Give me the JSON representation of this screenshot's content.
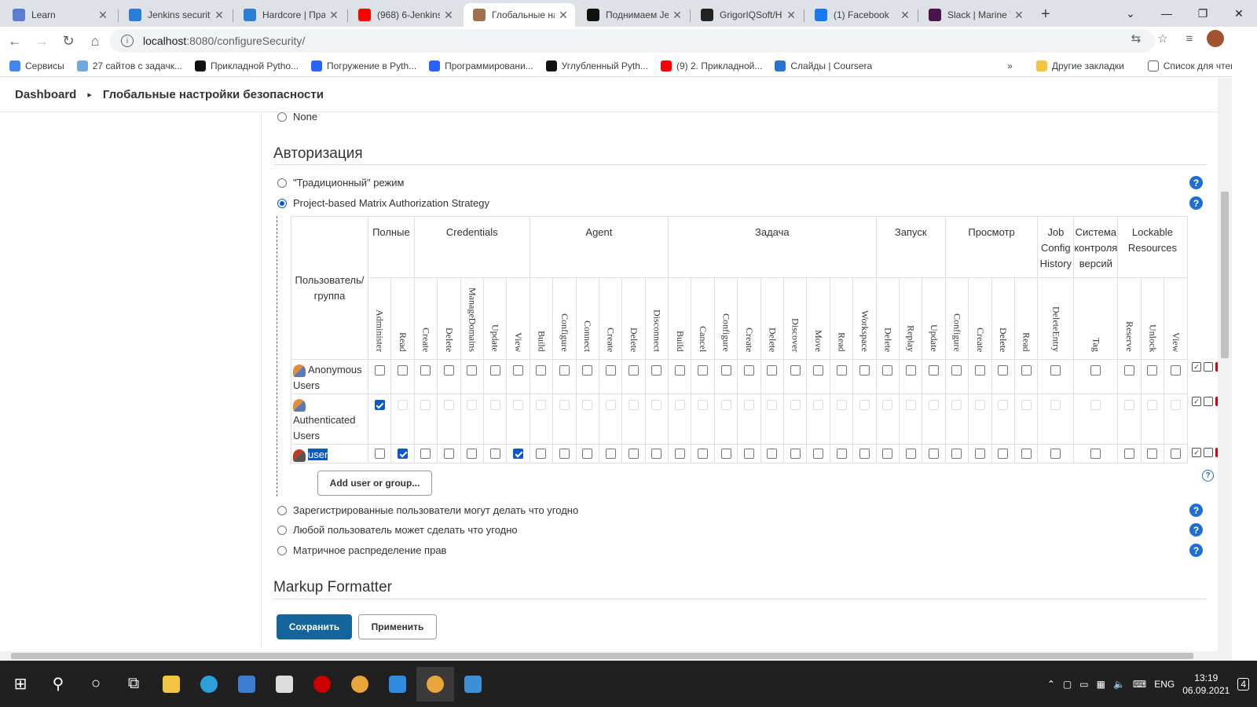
{
  "browser": {
    "tabs": [
      {
        "title": "Learn",
        "fav_color": "#5b7ccf",
        "active": false
      },
      {
        "title": "Jenkins security",
        "fav_color": "#2a7fd4",
        "active": false
      },
      {
        "title": "Hardcore | Прак",
        "fav_color": "#2a7fd4",
        "active": false
      },
      {
        "title": "(968) 6-Jenkins",
        "fav_color": "#ff0000",
        "active": false
      },
      {
        "title": "Глобальные на",
        "fav_color": "#a07050",
        "active": true
      },
      {
        "title": "Поднимаем Jen",
        "fav_color": "#111111",
        "active": false
      },
      {
        "title": "GrigorIQSoft/H",
        "fav_color": "#222222",
        "active": false
      },
      {
        "title": "(1) Facebook",
        "fav_color": "#1877f2",
        "active": false
      },
      {
        "title": "Slack | Marine Y",
        "fav_color": "#4a154b",
        "active": false
      }
    ],
    "url_host": "localhost",
    "url_path": ":8080/configureSecurity/",
    "bookmarks": [
      {
        "label": "Сервисы",
        "color": "#4285f4"
      },
      {
        "label": "27 сайтов с задачк...",
        "color": "#6fa8dc"
      },
      {
        "label": "Прикладной Pytho...",
        "color": "#111111"
      },
      {
        "label": "Погружение в Pyth...",
        "color": "#2962ff"
      },
      {
        "label": "Программировани...",
        "color": "#2962ff"
      },
      {
        "label": "Углубленный Pyth...",
        "color": "#111111"
      },
      {
        "label": "(9) 2. Прикладной...",
        "color": "#ff0000"
      },
      {
        "label": "Слайды | Coursera",
        "color": "#2a73cc"
      }
    ],
    "bookmarks_more": "»",
    "other_bookmarks": "Другие закладки",
    "reading_list": "Список для чтения"
  },
  "header": {
    "crumb1": "Dashboard",
    "sep": "▸",
    "crumb2": "Глобальные настройки безопасности"
  },
  "security_realm": {
    "none_label": "None"
  },
  "authorization": {
    "title": "Авторизация",
    "options": [
      "\"Традиционный\" режим",
      "Project-based Matrix Authorization Strategy",
      "Зарегистрированные пользователи могут делать что угодно",
      "Любой пользователь может сделать что угодно",
      "Матричное распределение прав"
    ],
    "selected_index": 1
  },
  "matrix": {
    "user_col": "Пользователь/группа",
    "groups": [
      {
        "label": "Полные",
        "perms": [
          "Administer",
          "Read"
        ]
      },
      {
        "label": "Credentials",
        "perms": [
          "Create",
          "Delete",
          "ManageDomains",
          "Update",
          "View"
        ]
      },
      {
        "label": "Agent",
        "perms": [
          "Build",
          "Configure",
          "Connect",
          "Create",
          "Delete",
          "Disconnect"
        ]
      },
      {
        "label": "Задача",
        "perms": [
          "Build",
          "Cancel",
          "Configure",
          "Create",
          "Delete",
          "Discover",
          "Move",
          "Read",
          "Workspace"
        ]
      },
      {
        "label": "Запуск",
        "perms": [
          "Delete",
          "Replay",
          "Update"
        ]
      },
      {
        "label": "Просмотр",
        "perms": [
          "Configure",
          "Create",
          "Delete",
          "Read"
        ]
      },
      {
        "label": "Job Config History",
        "perms": [
          "DeleteEntry"
        ]
      },
      {
        "label": "Система контроля версий",
        "perms": [
          "Tag"
        ]
      },
      {
        "label": "Lockable Resources",
        "perms": [
          "Reserve",
          "Unlock",
          "View"
        ]
      }
    ],
    "rows": [
      {
        "name": "Anonymous Users",
        "checked": [],
        "disabled_after_admin": false,
        "icon": "group-icon"
      },
      {
        "name": "Authenticated Users",
        "checked": [
          0
        ],
        "disabled_after_admin": true,
        "icon": "group-icon"
      },
      {
        "name": "user",
        "checked": [
          1,
          6
        ],
        "disabled_after_admin": false,
        "icon": "user-icon",
        "selected": true
      }
    ],
    "add_button": "Add user or group..."
  },
  "markup": {
    "title": "Markup Formatter"
  },
  "buttons": {
    "save": "Сохранить",
    "apply": "Применить"
  },
  "taskbar": {
    "lang": "ENG",
    "time": "13:19",
    "date": "06.09.2021",
    "notifications": "4"
  }
}
